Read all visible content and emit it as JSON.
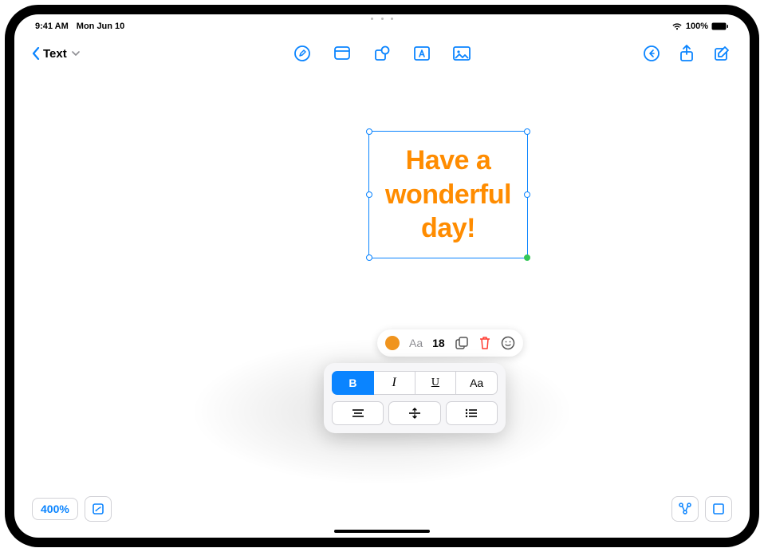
{
  "status": {
    "time": "9:41 AM",
    "date": "Mon Jun 10",
    "battery": "100%"
  },
  "toolbar": {
    "back_label": "Text"
  },
  "textbox": {
    "content": "Have a wonderful day!",
    "color": "#ff8c00"
  },
  "context_bar": {
    "font_label": "Aa",
    "font_size": "18"
  },
  "format_panel": {
    "bold": "B",
    "italic": "I",
    "underline": "U",
    "textcase": "Aa"
  },
  "bottom": {
    "zoom": "400%"
  }
}
